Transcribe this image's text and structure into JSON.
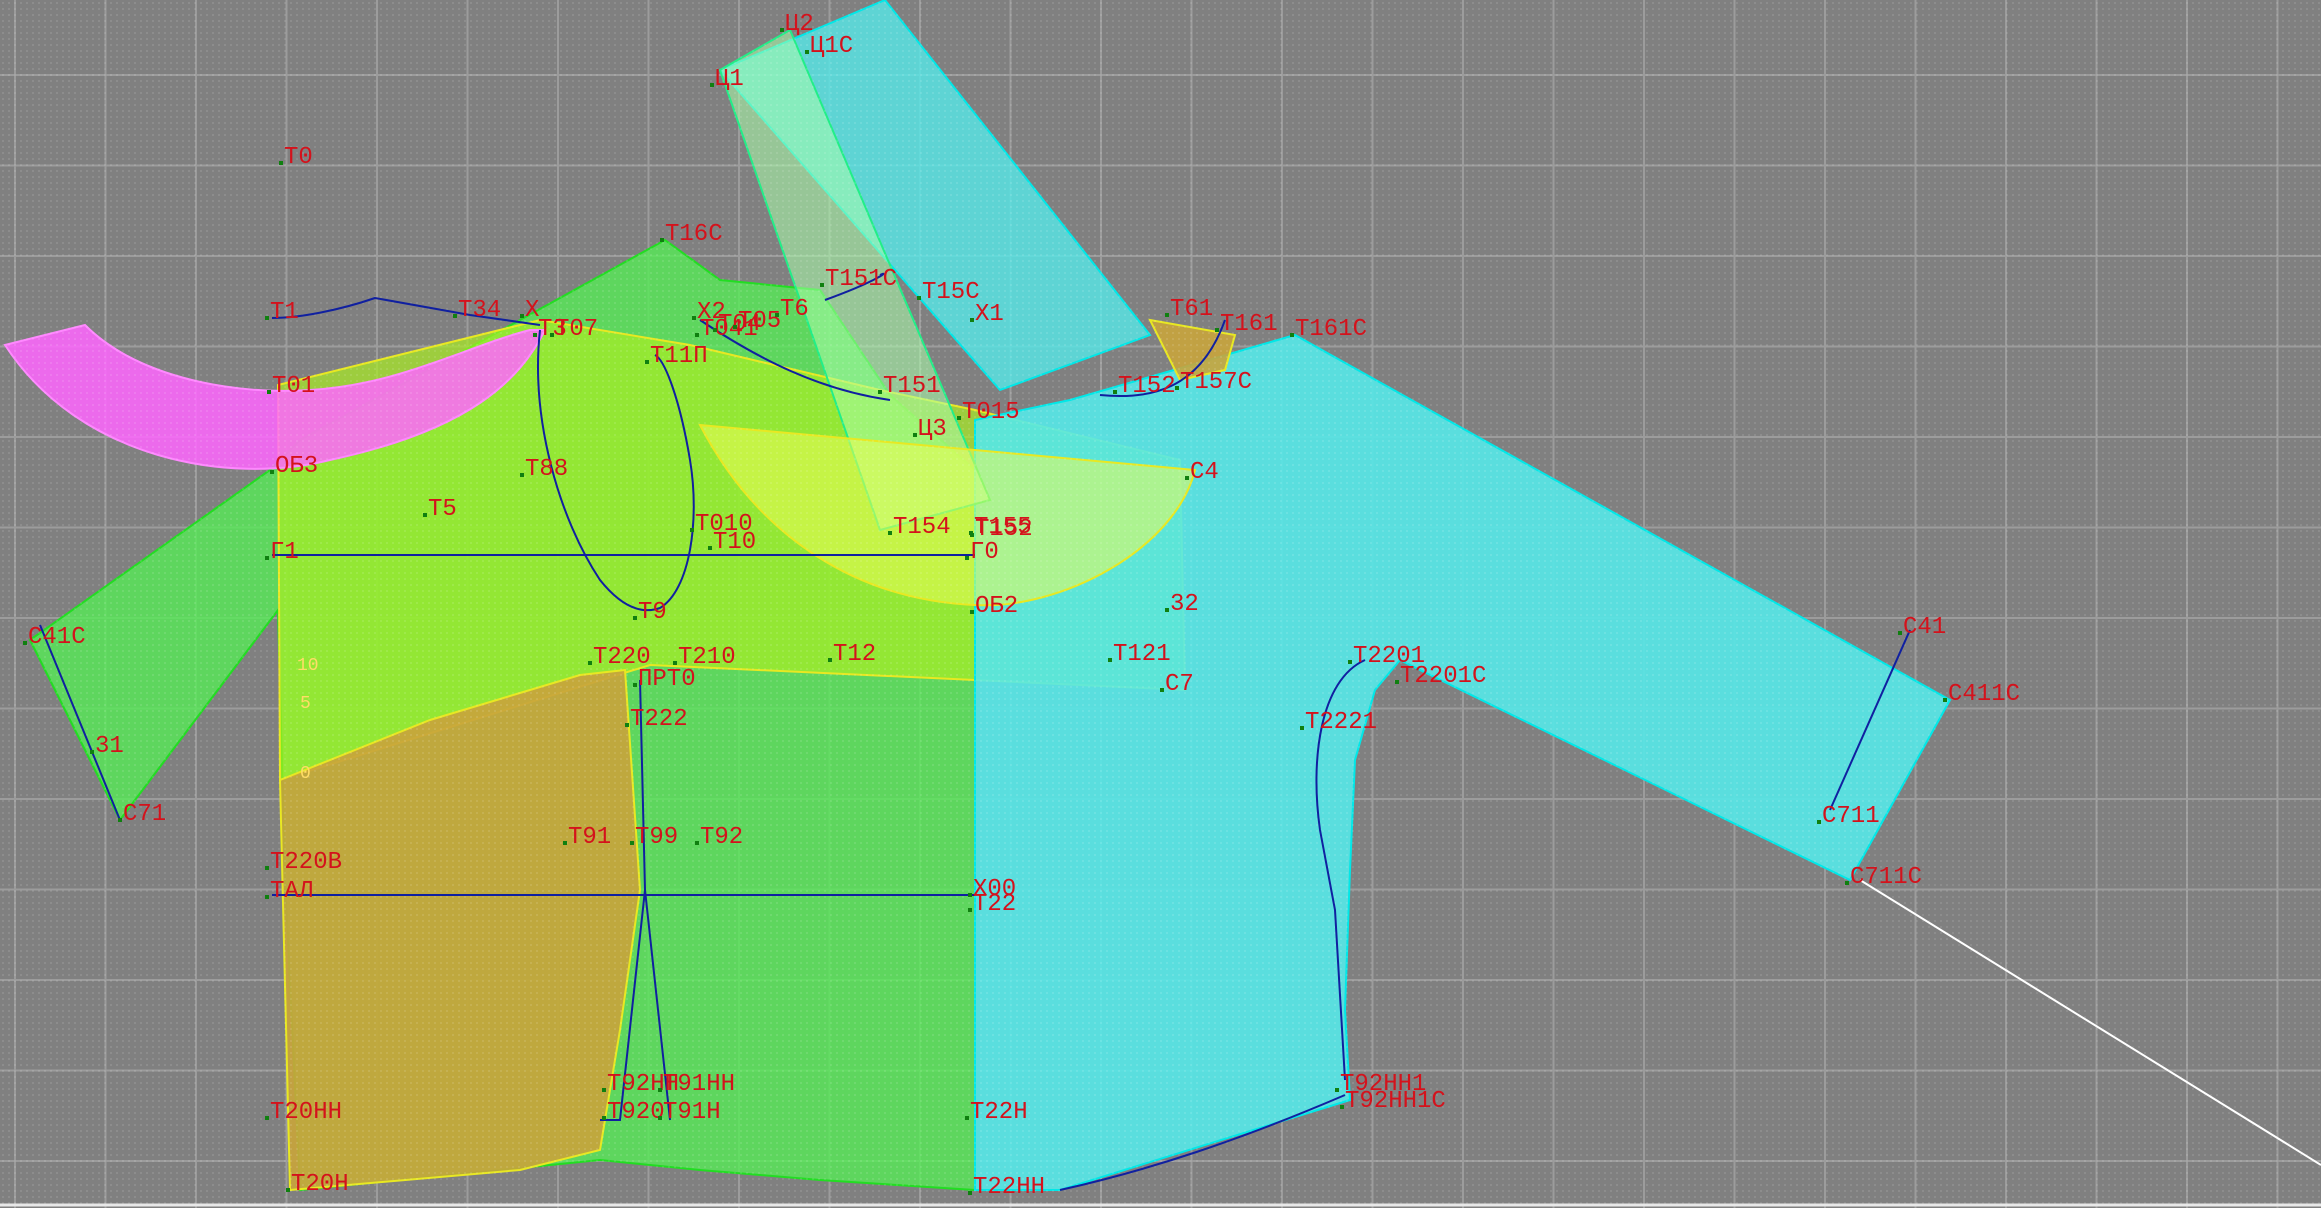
{
  "workspace": {
    "background_color": "#808080",
    "grid_color": "#9c9c9c"
  },
  "pieces": [
    {
      "name": "collar",
      "color": "#ff66ff"
    },
    {
      "name": "front-body",
      "color": "#99ee22"
    },
    {
      "name": "back-body",
      "color": "#55ee99"
    },
    {
      "name": "lining-panel",
      "color": "#c8a43c"
    },
    {
      "name": "sleeve",
      "color": "#55e8e8"
    },
    {
      "name": "yoke",
      "color": "#eeff55"
    }
  ],
  "line_colors": {
    "construction": "#1020a0",
    "contour_green": "#22dd22",
    "contour_cyan": "#00e8e8",
    "contour_yellow": "#e8e822",
    "guide": "#ffffff"
  },
  "labels": [
    "Ц2",
    "Ц1С",
    "Ц1",
    "Т0",
    "Т16С",
    "Т151С",
    "Т15С",
    "Т6",
    "Х1",
    "Т61",
    "Т161",
    "Т161С",
    "Т1",
    "Т34",
    "Х",
    "Т3",
    "Т07",
    "Х2",
    "Т041",
    "Т04",
    "Т05",
    "Т11П",
    "Т01",
    "Т151",
    "Т015",
    "Т152",
    "Т157С",
    "Ц3",
    "ОБ3",
    "Т88",
    "С4",
    "Т5",
    "Т010",
    "Т10",
    "Т154",
    "Т155",
    "Т152",
    "Г1",
    "Г0",
    "ОБ2",
    "Т9",
    "32",
    "С41С",
    "Т220",
    "Т210",
    "Т12",
    "Т121",
    "Т2201",
    "Т2201С",
    "С7",
    "ПРТ0",
    "Т222",
    "Т2221",
    "31",
    "С71",
    "Т91",
    "Т99",
    "Т92",
    "Т220В",
    "ТАЛ",
    "Х00",
    "Т22",
    "С41",
    "С411С",
    "С711",
    "С711С",
    "Т92НН1",
    "Т92НН1С",
    "Т92НН",
    "Т91НН",
    "Т920",
    "Т91Н",
    "Т22Н",
    "Т20НН",
    "Т22НН",
    "Т20Н"
  ],
  "ruler_marks": [
    "10",
    "5",
    "0"
  ]
}
